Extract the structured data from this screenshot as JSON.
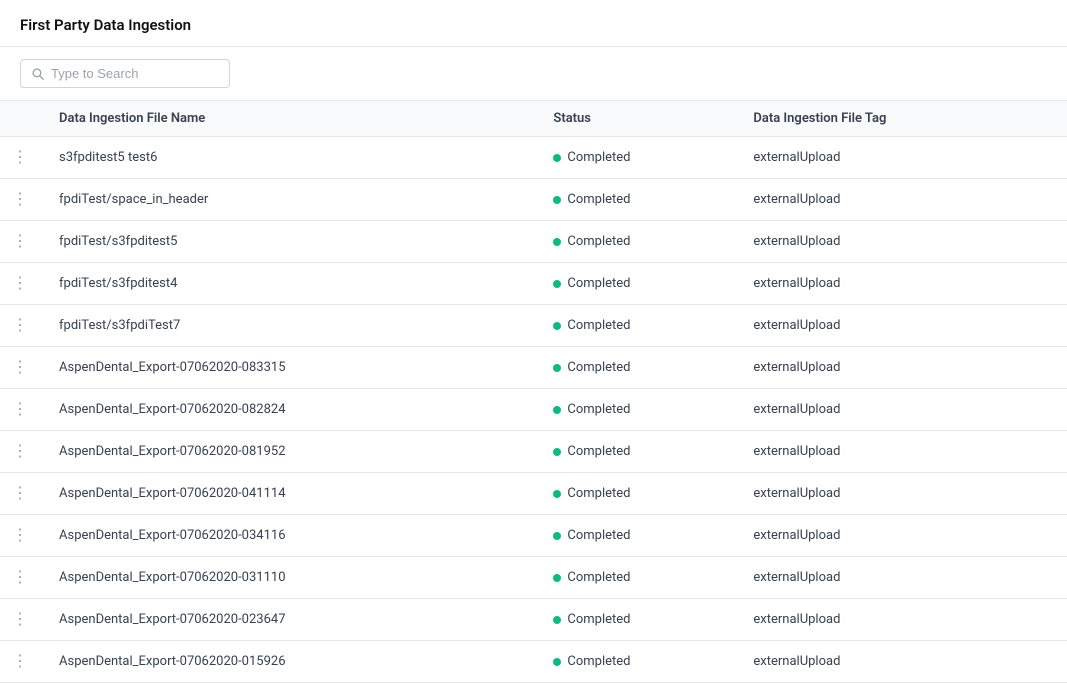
{
  "header": {
    "title": "First Party Data Ingestion"
  },
  "search": {
    "placeholder": "Type to Search"
  },
  "table": {
    "columns": [
      {
        "key": "menu",
        "label": ""
      },
      {
        "key": "fileName",
        "label": "Data Ingestion File Name"
      },
      {
        "key": "status",
        "label": "Status"
      },
      {
        "key": "tag",
        "label": "Data Ingestion File Tag"
      }
    ],
    "rows": [
      {
        "id": 1,
        "fileName": "s3fpditest5 test6",
        "status": "Completed",
        "tag": "externalUpload"
      },
      {
        "id": 2,
        "fileName": "fpdiTest/space_in_header",
        "status": "Completed",
        "tag": "externalUpload"
      },
      {
        "id": 3,
        "fileName": "fpdiTest/s3fpditest5",
        "status": "Completed",
        "tag": "externalUpload"
      },
      {
        "id": 4,
        "fileName": "fpdiTest/s3fpditest4",
        "status": "Completed",
        "tag": "externalUpload"
      },
      {
        "id": 5,
        "fileName": "fpdiTest/s3fpdiTest7",
        "status": "Completed",
        "tag": "externalUpload"
      },
      {
        "id": 6,
        "fileName": "AspenDental_Export-07062020-083315",
        "status": "Completed",
        "tag": "externalUpload"
      },
      {
        "id": 7,
        "fileName": "AspenDental_Export-07062020-082824",
        "status": "Completed",
        "tag": "externalUpload"
      },
      {
        "id": 8,
        "fileName": "AspenDental_Export-07062020-081952",
        "status": "Completed",
        "tag": "externalUpload"
      },
      {
        "id": 9,
        "fileName": "AspenDental_Export-07062020-041114",
        "status": "Completed",
        "tag": "externalUpload"
      },
      {
        "id": 10,
        "fileName": "AspenDental_Export-07062020-034116",
        "status": "Completed",
        "tag": "externalUpload"
      },
      {
        "id": 11,
        "fileName": "AspenDental_Export-07062020-031110",
        "status": "Completed",
        "tag": "externalUpload"
      },
      {
        "id": 12,
        "fileName": "AspenDental_Export-07062020-023647",
        "status": "Completed",
        "tag": "externalUpload"
      },
      {
        "id": 13,
        "fileName": "AspenDental_Export-07062020-015926",
        "status": "Completed",
        "tag": "externalUpload"
      }
    ],
    "statusColors": {
      "Completed": "#10b981"
    }
  }
}
